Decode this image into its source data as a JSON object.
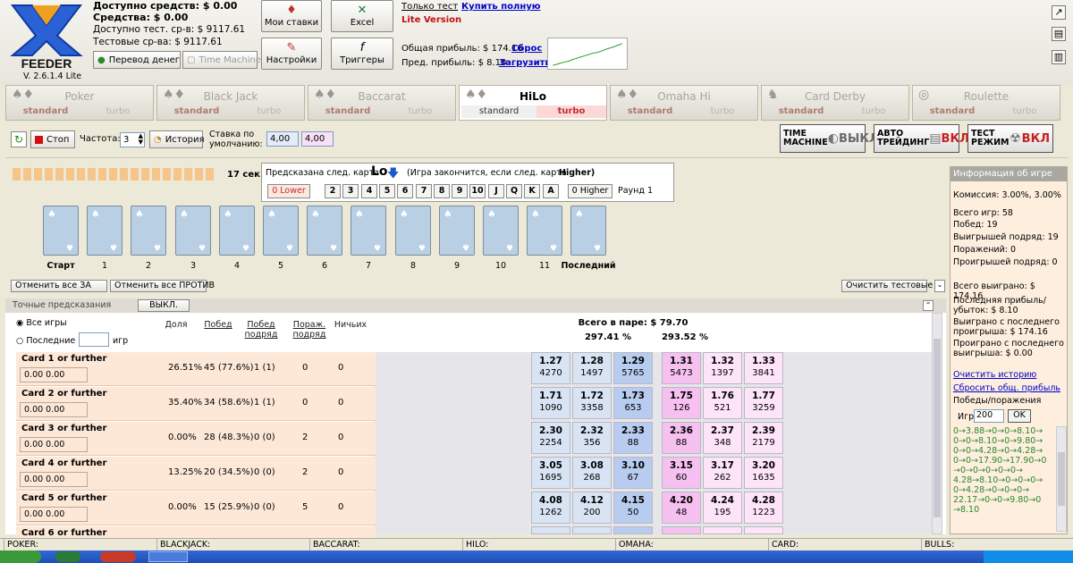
{
  "app": {
    "logo_text": "FEEDER",
    "version": "V. 2.6.1.4 Lite"
  },
  "funds": {
    "available": "Доступно средств: $ 0.00",
    "funds": "Средства: $ 0.00",
    "test_available": "Доступно тест. ср-в: $ 9117.61",
    "test_funds": "Тестовые ср-ва: $ 9117.61"
  },
  "header_buttons": {
    "transfer": "Перевод денег",
    "time_machine": "Time Machine",
    "my_bets": "Мои ставки",
    "settings": "Настройки",
    "excel": "Excel",
    "triggers": "Триггеры"
  },
  "header_info": {
    "test_only": "Только тест",
    "buy_full": "Купить полную",
    "lite": "Lite Version",
    "total_profit": "Общая прибыль: $ 174.16",
    "reset": "Сброс",
    "prev_profit": "Пред. прибыль: $ 8.10",
    "load": "Загрузить"
  },
  "sparkline": [
    0,
    4,
    8,
    12,
    15,
    18,
    22,
    28,
    31,
    36,
    40,
    44,
    48,
    52,
    56,
    58,
    62,
    66,
    72,
    76,
    80,
    84,
    90,
    94,
    100
  ],
  "tabs": [
    {
      "name": "Poker",
      "sub1": "standard",
      "sub2": "turbo",
      "icon": "cards-icon"
    },
    {
      "name": "Black Jack",
      "sub1": "standard",
      "sub2": "turbo",
      "icon": "cards-icon"
    },
    {
      "name": "Baccarat",
      "sub1": "standard",
      "sub2": "turbo",
      "icon": "cards-icon"
    },
    {
      "name": "HiLo",
      "sub1": "standard",
      "sub2": "turbo",
      "icon": "cards-icon"
    },
    {
      "name": "Omaha Hi",
      "sub1": "standard",
      "sub2": "turbo",
      "icon": "cards-icon"
    },
    {
      "name": "Card Derby",
      "sub1": "standard",
      "sub2": "turbo",
      "icon": "horse-icon"
    },
    {
      "name": "Roulette",
      "sub1": "standard",
      "sub2": "turbo",
      "icon": "roulette-icon"
    }
  ],
  "control": {
    "stop": "Стоп",
    "freq_label": "Частота:",
    "freq_value": "3",
    "history": "История",
    "default_bet_label": "Ставка по умолчанию:",
    "bet_blue": "4,00",
    "bet_pink": "4,00",
    "auto": [
      {
        "l1": "TIME",
        "l2": "MACHINE",
        "state": "ВЫКЛ"
      },
      {
        "l1": "АВТО",
        "l2": "ТРЕЙДИНГ",
        "state": "ВКЛ"
      },
      {
        "l1": "ТЕСТ",
        "l2": "РЕЖИМ",
        "state": "ВКЛ"
      }
    ]
  },
  "game": {
    "timer": "17 сек.",
    "prediction_label": "Предсказана след. карта",
    "prediction": "Lo",
    "condition": "(Игра закончится, если след. карта",
    "condition_bold": "Higher)",
    "lower_btn": "0 Lower",
    "higher_btn": "0 Higher",
    "round": "Раунд 1",
    "keys": [
      "2",
      "3",
      "4",
      "5",
      "6",
      "7",
      "8",
      "9",
      "10",
      "J",
      "Q",
      "K",
      "A"
    ],
    "card_labels": [
      "Старт",
      "1",
      "2",
      "3",
      "4",
      "5",
      "6",
      "7",
      "8",
      "9",
      "10",
      "11",
      "Последний"
    ],
    "cancel_for": "Отменить все ЗА",
    "cancel_against": "Отменить все ПРОТИВ",
    "clear_test": "Очистить тестовые"
  },
  "table": {
    "section": "Точные предсказания",
    "toggle": "ВЫКЛ.",
    "all_games": "Все игры",
    "last": "Последние",
    "games": "игр",
    "headers": {
      "share": "Доля",
      "wins": "Побед",
      "wins_row": "Побед подряд",
      "losses_row": "Пораж. подряд",
      "draws": "Ничьих"
    },
    "pair_total": "Всего в паре: $ 79.70",
    "pct_left": "297.41 %",
    "pct_right": "293.52 %",
    "rows": [
      {
        "name": "Card 1 or further",
        "in1": "0.00",
        "in2": "0.00",
        "share": "26.51%",
        "wins": "45 (77.6%)",
        "wrow": "1 (1)",
        "lrow": "0",
        "draws": "0",
        "odds": [
          [
            "1.27",
            "4270"
          ],
          [
            "1.28",
            "1497"
          ],
          [
            "1.29",
            "5765"
          ],
          [
            "1.31",
            "5473"
          ],
          [
            "1.32",
            "1397"
          ],
          [
            "1.33",
            "3841"
          ]
        ]
      },
      {
        "name": "Card 2 or further",
        "in1": "0.00",
        "in2": "0.00",
        "share": "35.40%",
        "wins": "34 (58.6%)",
        "wrow": "1 (1)",
        "lrow": "0",
        "draws": "0",
        "odds": [
          [
            "1.71",
            "1090"
          ],
          [
            "1.72",
            "3358"
          ],
          [
            "1.73",
            "653"
          ],
          [
            "1.75",
            "126"
          ],
          [
            "1.76",
            "521"
          ],
          [
            "1.77",
            "3259"
          ]
        ]
      },
      {
        "name": "Card 3 or further",
        "in1": "0.00",
        "in2": "0.00",
        "share": "0.00%",
        "wins": "28 (48.3%)",
        "wrow": "0 (0)",
        "lrow": "2",
        "draws": "0",
        "odds": [
          [
            "2.30",
            "2254"
          ],
          [
            "2.32",
            "356"
          ],
          [
            "2.33",
            "88"
          ],
          [
            "2.36",
            "88"
          ],
          [
            "2.37",
            "348"
          ],
          [
            "2.39",
            "2179"
          ]
        ]
      },
      {
        "name": "Card 4 or further",
        "in1": "0.00",
        "in2": "0.00",
        "share": "13.25%",
        "wins": "20 (34.5%)",
        "wrow": "0 (0)",
        "lrow": "2",
        "draws": "0",
        "odds": [
          [
            "3.05",
            "1695"
          ],
          [
            "3.08",
            "268"
          ],
          [
            "3.10",
            "67"
          ],
          [
            "3.15",
            "60"
          ],
          [
            "3.17",
            "262"
          ],
          [
            "3.20",
            "1635"
          ]
        ]
      },
      {
        "name": "Card 5 or further",
        "in1": "0.00",
        "in2": "0.00",
        "share": "0.00%",
        "wins": "15 (25.9%)",
        "wrow": "0 (0)",
        "lrow": "5",
        "draws": "0",
        "odds": [
          [
            "4.08",
            "1262"
          ],
          [
            "4.12",
            "200"
          ],
          [
            "4.15",
            "50"
          ],
          [
            "4.20",
            "48"
          ],
          [
            "4.24",
            "195"
          ],
          [
            "4.28",
            "1223"
          ]
        ]
      },
      {
        "name": "Card 6 or further",
        "in1": "",
        "in2": "",
        "share": "",
        "wins": "",
        "wrow": "",
        "lrow": "",
        "draws": "",
        "odds": [
          [
            "",
            ""
          ],
          [
            "",
            ""
          ],
          [
            "",
            ""
          ],
          [
            "",
            ""
          ],
          [
            "",
            ""
          ],
          [
            "",
            ""
          ]
        ]
      }
    ]
  },
  "info": {
    "title": "Информация об игре",
    "commission": "Комиссия: 3.00%, 3.00%",
    "total_games": "Всего игр: 58",
    "wins": "Побед: 19",
    "wins_row": "Выигрышей подряд: 19",
    "losses": "Поражений: 0",
    "losses_row": "Проигрышей подряд: 0",
    "total_won": "Всего выиграно: $ 174.16",
    "last_pl": "Последняя прибыль/убыток: $ 8.10",
    "won_since": "Выиграно с последнего проигрыша: $ 174.16",
    "lost_since": "Проиграно с последнего выигрыша: $ 0.00",
    "clear_history": "Очистить историю",
    "reset_profit": "Сбросить общ. прибыль",
    "wl_label": "Победы/поражения",
    "games_label": "Игр",
    "games_value": "200",
    "ok": "OK",
    "log": [
      "0→3.88→0→0→8.10→",
      "0→0→8.10→0→9.80→",
      "0→0→4.28→0→4.28→",
      "0→0→17.90→17.90→0",
      "→0→0→0→0→0→",
      "4.28→8.10→0→0→0→",
      "0→4.28→0→0→0→",
      "22.17→0→0→9.80→0",
      "→8.10"
    ]
  },
  "statusbar": [
    "POKER:",
    "BLACKJACK:",
    "BACCARAT:",
    "HILO:",
    "OMAHA:",
    "CARD:",
    "BULLS:"
  ]
}
